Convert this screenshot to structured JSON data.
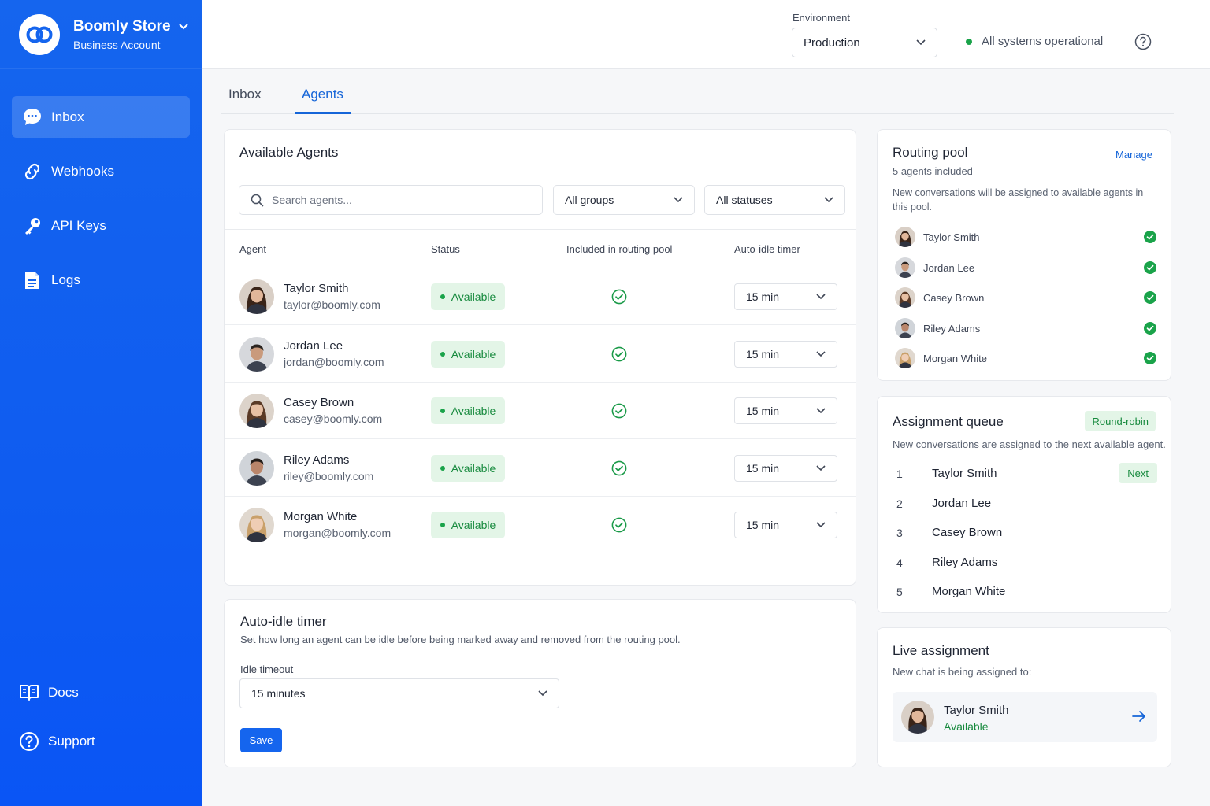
{
  "app": {
    "brand_name": "Boomly Store",
    "brand_subtitle": "Business Account",
    "logo_icon": "infinity-rings-logo"
  },
  "sidebar": {
    "items": [
      {
        "label": "Inbox",
        "icon": "chat-bubble-icon",
        "active": true
      },
      {
        "label": "Webhooks",
        "icon": "webhook-icon",
        "active": false
      },
      {
        "label": "API Keys",
        "icon": "key-icon",
        "active": false
      },
      {
        "label": "Logs",
        "icon": "document-icon",
        "active": false
      }
    ],
    "bottom_items": [
      {
        "label": "Docs",
        "icon": "book-icon"
      },
      {
        "label": "Support",
        "icon": "question-circle-icon"
      }
    ]
  },
  "topbar": {
    "environment_label": "Environment",
    "environment_value": "Production",
    "system_status": "All systems operational",
    "status_color": "#1aa34a"
  },
  "tabs": [
    {
      "label": "Inbox",
      "active": false
    },
    {
      "label": "Agents",
      "active": true
    }
  ],
  "agents": {
    "title": "Available Agents",
    "search_placeholder": "Search agents...",
    "group_filter": "All groups",
    "status_filter": "All statuses",
    "columns": [
      "Agent",
      "Status",
      "Included in routing pool",
      "Auto-idle timer"
    ],
    "rows": [
      {
        "name": "Taylor Smith",
        "email": "taylor@boomly.com",
        "status": "Available",
        "included": true,
        "timer": "15 min"
      },
      {
        "name": "Jordan Lee",
        "email": "jordan@boomly.com",
        "status": "Available",
        "included": true,
        "timer": "15 min"
      },
      {
        "name": "Casey Brown",
        "email": "casey@boomly.com",
        "status": "Available",
        "included": true,
        "timer": "15 min"
      },
      {
        "name": "Riley Adams",
        "email": "riley@boomly.com",
        "status": "Available",
        "included": true,
        "timer": "15 min"
      },
      {
        "name": "Morgan White",
        "email": "morgan@boomly.com",
        "status": "Available",
        "included": true,
        "timer": "15 min"
      }
    ]
  },
  "idle": {
    "title": "Auto-idle timer",
    "description": "Set how long an agent can be idle before being marked away and removed from the routing pool.",
    "field_label": "Idle timeout",
    "value": "15 minutes",
    "save_label": "Save"
  },
  "pool": {
    "title": "Routing pool",
    "manage_label": "Manage",
    "count_text": "5 agents included",
    "description": "New conversations will be assigned to available agents in this pool.",
    "members": [
      "Taylor Smith",
      "Jordan Lee",
      "Casey Brown",
      "Riley Adams",
      "Morgan White"
    ]
  },
  "queue": {
    "title": "Assignment queue",
    "mode": "Round-robin",
    "description": "New conversations are assigned to the next available agent.",
    "next_label": "Next",
    "entries": [
      {
        "pos": "1",
        "name": "Taylor Smith"
      },
      {
        "pos": "2",
        "name": "Jordan Lee"
      },
      {
        "pos": "3",
        "name": "Casey Brown"
      },
      {
        "pos": "4",
        "name": "Riley Adams"
      },
      {
        "pos": "5",
        "name": "Morgan White"
      }
    ]
  },
  "live": {
    "title": "Live assignment",
    "description": "New chat is being assigned to:",
    "agent_name": "Taylor Smith",
    "agent_status": "Available"
  },
  "colors": {
    "accent": "#1565ee",
    "success": "#178a3e",
    "success_bg": "#e3f5e7"
  }
}
